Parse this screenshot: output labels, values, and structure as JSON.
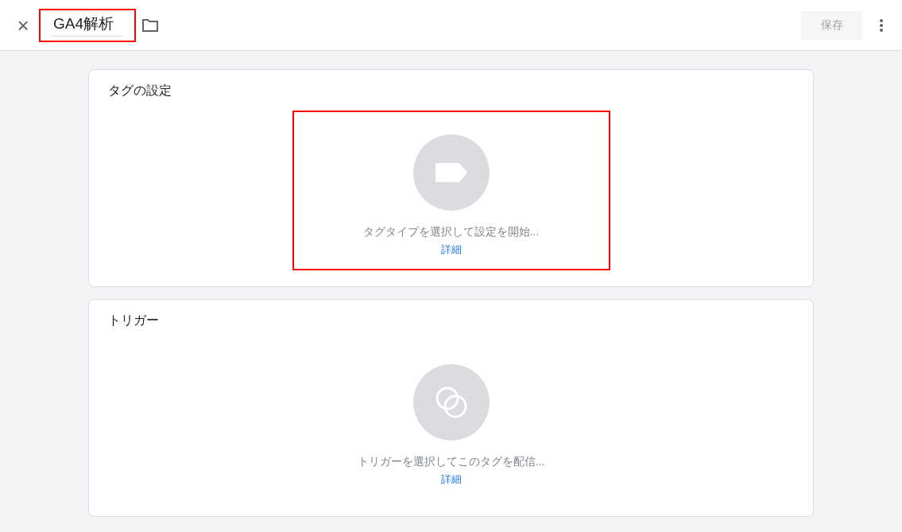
{
  "header": {
    "close_label": "×",
    "title": {
      "value": "GA4解析",
      "highlighted": true
    },
    "save": {
      "label": "保存",
      "disabled": true
    }
  },
  "sections": [
    {
      "kind": "tag",
      "title": "タグの設定",
      "prompt": "タグタイプを選択して設定を開始...",
      "link": "詳細",
      "highlighted": true
    },
    {
      "kind": "trigger",
      "title": "トリガー",
      "prompt": "トリガーを選択してこのタグを配信...",
      "link": "詳細",
      "highlighted": false
    }
  ]
}
